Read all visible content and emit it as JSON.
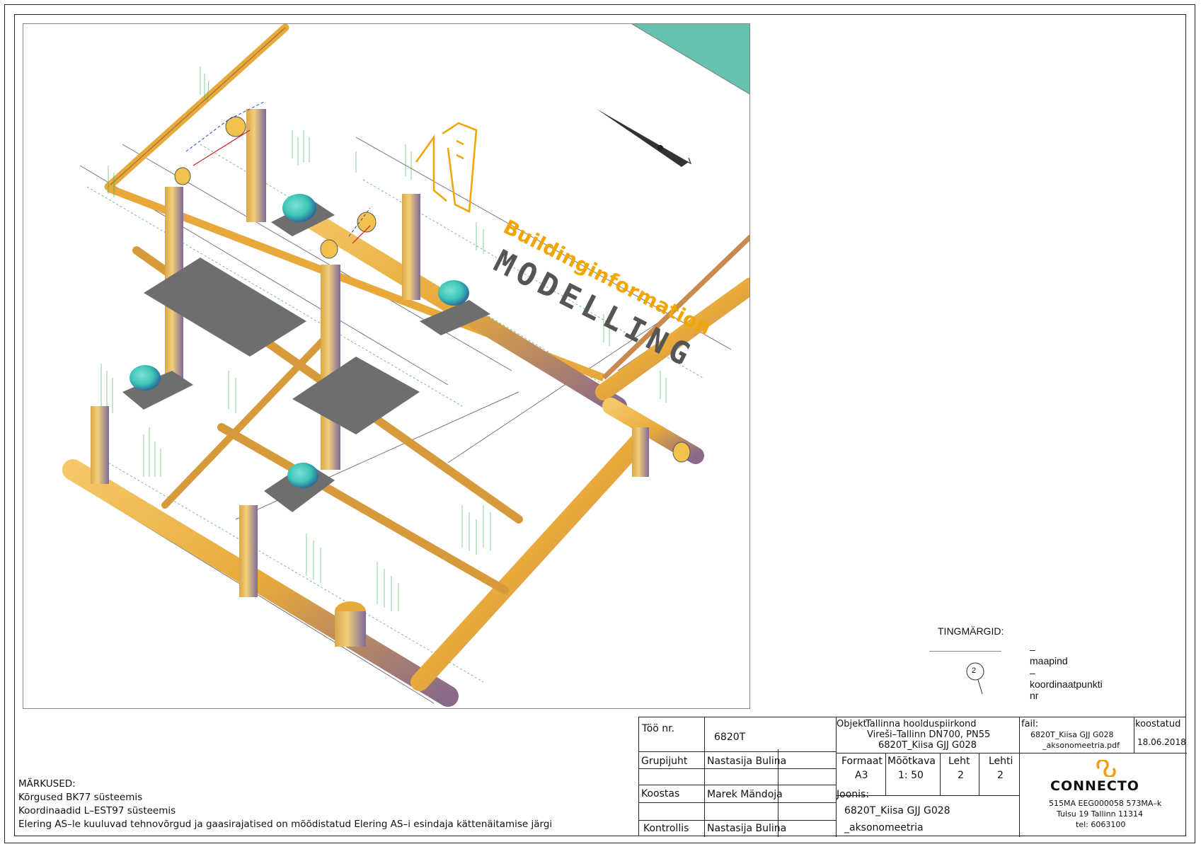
{
  "watermark": {
    "line1": "Buildinginformation",
    "line2": "MODELLING"
  },
  "legend": {
    "title": "TINGMÄRGID:",
    "items": [
      {
        "symbol": "line",
        "label": "– maapind"
      },
      {
        "symbol": "circle",
        "number": "2",
        "label": "– koordinaatpunkti nr"
      }
    ]
  },
  "notes": {
    "heading": "MÄRKUSED:",
    "lines": [
      "Kõrgused BK77 süsteemis",
      "Koordinaadid L–EST97 süsteemis",
      "Elering AS–le kuuluvad tehnovõrgud ja gaasirajatised on mõõdistatud Elering AS–i esindaja kättenäitamise järgi"
    ]
  },
  "title_block": {
    "too_nr_label": "Töö nr.",
    "too_nr_value": "6820T",
    "grupijuht_label": "Grupijuht",
    "grupijuht_value": "Nastasija Bulina",
    "koostas_label": "Koostas",
    "koostas_value": "Marek Mändoja",
    "kontrollis_label": "Kontrollis",
    "kontrollis_value": "Nastasija Bulina",
    "objekt_label": "Objekt:",
    "objekt_lines": [
      "Tallinna hoolduspiirkond",
      "Vireši–Tallinn DN700, PN55",
      "6820T_Kiisa GJJ G028"
    ],
    "formaat_label": "Formaat",
    "formaat_value": "A3",
    "mootkava_label": "Mõõtkava",
    "mootkava_value": "1: 50",
    "leht_label": "Leht",
    "leht_value": "2",
    "lehti_label": "Lehti",
    "lehti_value": "2",
    "joonis_label": "Joonis:",
    "joonis_lines": [
      "6820T_Kiisa GJJ G028",
      "_aksonomeetria"
    ],
    "fail_label": "fail:",
    "fail_lines": [
      "6820T_Kiisa GJJ G028",
      "_aksonomeetria.pdf"
    ],
    "koostatud_label": "koostatud",
    "koostatud_value": "18.06.2018",
    "company_name": "CONNECTO",
    "company_lines": [
      "515MA EEG000058 573MA–k",
      "Tulsu 19 Tallinn 11314",
      "tel: 6063100"
    ]
  },
  "colors": {
    "pipe": "#e8a93a",
    "pipe_dark": "#a87722",
    "valve": "#3ec6b7",
    "base": "#6e6e6e",
    "teal_area": "#66c2b0",
    "watermark_orange": "#f0a500",
    "watermark_gray": "#555555",
    "logo_orange": "#f39c12"
  }
}
